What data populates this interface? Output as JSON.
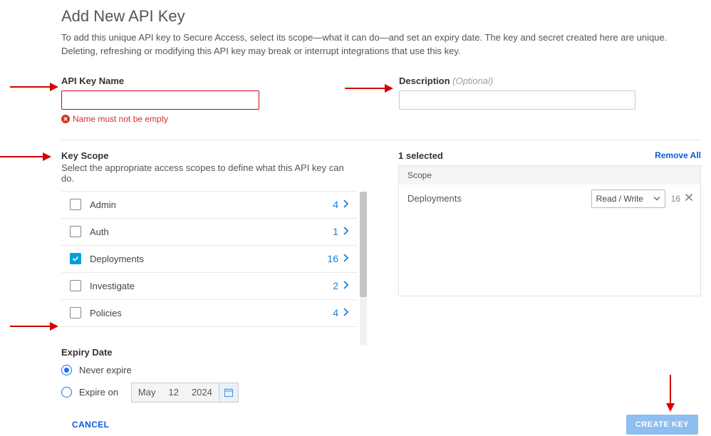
{
  "title": "Add New API Key",
  "intro": "To add this unique API key to Secure Access, select its scope—what it can do—and set an expiry date. The key and secret created here are unique. Deleting, refreshing or modifying this API key may break or interrupt integrations that use this key.",
  "fields": {
    "name_label": "API Key Name",
    "name_value": "",
    "name_error": "Name must not be empty",
    "desc_label": "Description",
    "desc_optional": "(Optional)",
    "desc_value": ""
  },
  "scope": {
    "header": "Key Scope",
    "sub": "Select the appropriate access scopes to define what this API key can do.",
    "items": [
      {
        "label": "Admin",
        "count": "4",
        "checked": false
      },
      {
        "label": "Auth",
        "count": "1",
        "checked": false
      },
      {
        "label": "Deployments",
        "count": "16",
        "checked": true
      },
      {
        "label": "Investigate",
        "count": "2",
        "checked": false
      },
      {
        "label": "Policies",
        "count": "4",
        "checked": false
      }
    ]
  },
  "selected": {
    "header": "1 selected",
    "remove_all": "Remove All",
    "col_header": "Scope",
    "rows": [
      {
        "name": "Deployments",
        "perm": "Read / Write",
        "count": "16"
      }
    ]
  },
  "expiry": {
    "header": "Expiry Date",
    "never_label": "Never expire",
    "on_label": "Expire on",
    "date_month": "May",
    "date_day": "12",
    "date_year": "2024",
    "never_selected": true
  },
  "actions": {
    "cancel": "CANCEL",
    "create": "CREATE KEY"
  }
}
